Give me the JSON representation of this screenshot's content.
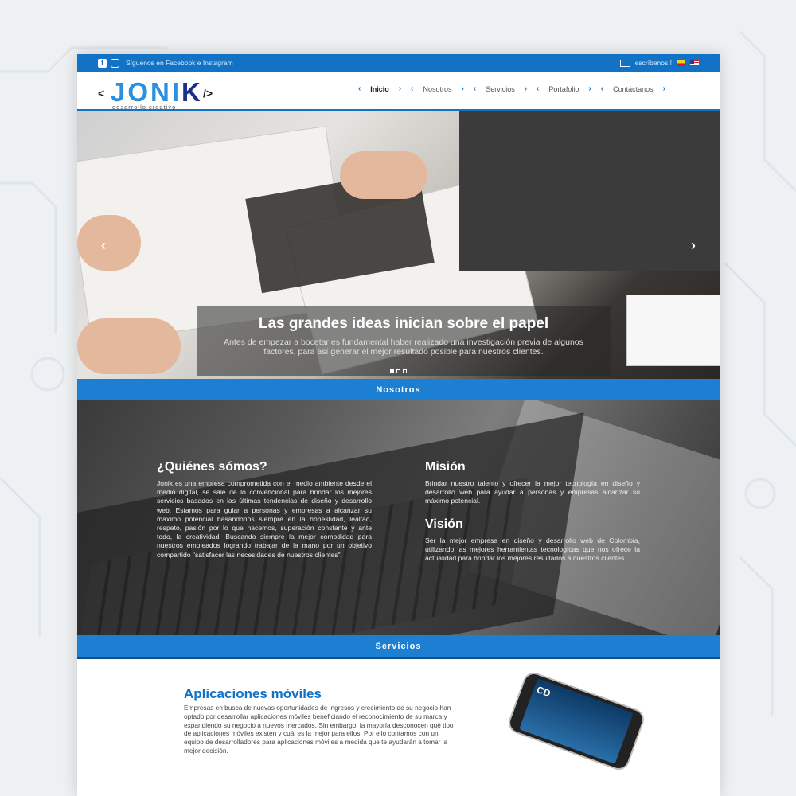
{
  "topbar": {
    "social_text": "Síguenos en Facebook e Instagram",
    "email_text": "escríbenos !"
  },
  "logo": {
    "open_bracket": "<",
    "close_bracket": "/>",
    "word_main": "JONI",
    "word_accent": "K",
    "tagline": "desarrollo creativo"
  },
  "nav": {
    "items": [
      "Inicio",
      "Nosotros",
      "Servicios",
      "Portafolio",
      "Contáctanos"
    ],
    "active": "Inicio"
  },
  "hero": {
    "title": "Las grandes ideas inician sobre el papel",
    "text": "Antes de empezar a bocetar es fundamental haber realizado una investigación previa de algunos factores, para así generar el mejor resultado posible para nuestros clientes.",
    "prev": "‹",
    "next": "›"
  },
  "sections": {
    "nosotros": "Nosotros",
    "servicios": "Servicios"
  },
  "about": {
    "who_title": "¿Quiénes sómos?",
    "who_text": "Jonik es una empresa comprometida con el medio ambiente desde el medio digital, se sale de lo convencional para brindar los mejores servicios basados en las últimas tendencias de diseño y desarrollo web. Estamos para guiar a personas y empresas a alcanzar su máximo potencial basándonos siempre en la honestidad, lealtad, respeto, pasión por lo que hacemos, superación constante y ante todo, la creatividad. Buscando siempre la mejor comodidad para nuestros empleados logrando trabajar de la mano por un objetivo compartido \"satisfacer las necesidades de nuestros clientes\".",
    "mission_title": "Misión",
    "mission_text": "Brindar nuestro talento y ofrecer la mejor tecnología en diseño y desarrollo web para ayudar a personas y empresas alcanzar su máximo potencial.",
    "vision_title": "Visión",
    "vision_text": "Ser la mejor empresa en diseño y desarrollo web de Colombia, utilizando las mejores herramientas tecnologícas que nos ofrece la actualidad para brindar los mejores resultados a nuestros clientes."
  },
  "services": {
    "title": "Aplicaciones móviles",
    "text": "Empresas en busca de nuevas oportunidades de ingresos y crecimiento de su negocio han optado por desarrollar aplicaciones móviles beneficiando el reconocimiento de su marca y expandiendo su negocio a nuevos mercados. Sin embargo, la mayoría desconocen qué tipo de aplicaciones móviles existen y cuál es la mejor para ellos. Por ello contamos con un equipo de desarrolladores para aplicaciones móviles a medida que te ayudarán a tomar la mejor decisión."
  },
  "colors": {
    "primary": "#1273c6",
    "accent_light": "#2c8fe0",
    "logo_dark": "#1b2f8a"
  },
  "icons": [
    "facebook-icon",
    "instagram-icon",
    "mail-icon",
    "flag-colombia-icon",
    "flag-usa-icon",
    "chevron-icon",
    "phone-icon"
  ]
}
